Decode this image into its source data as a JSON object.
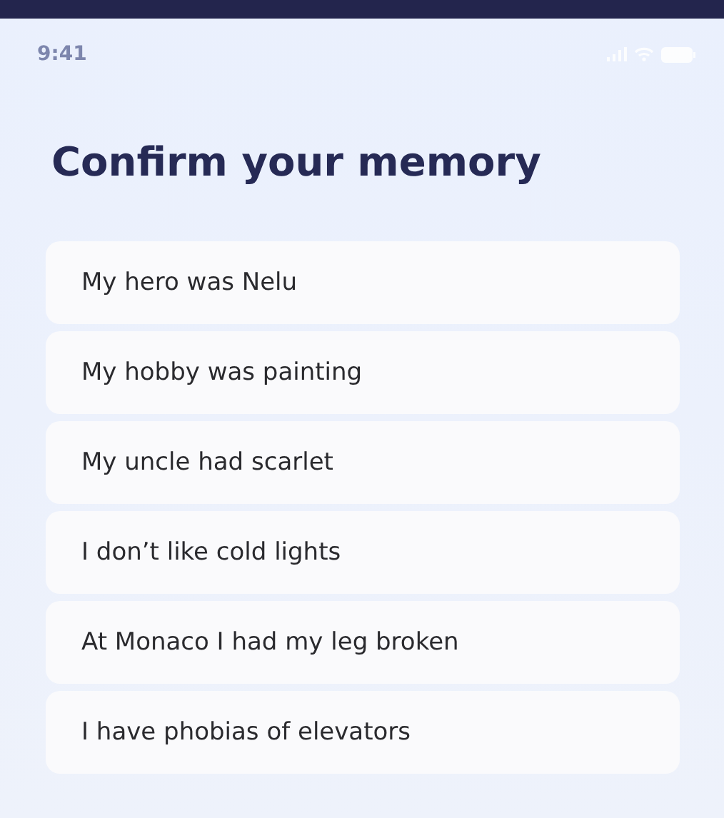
{
  "status_bar": {
    "time": "9:41"
  },
  "title": "Confirm your memory",
  "memories": [
    {
      "text": "My hero was Nelu"
    },
    {
      "text": "My hobby was painting"
    },
    {
      "text": "My uncle had scarlet"
    },
    {
      "text": "I don’t like cold lights"
    },
    {
      "text": "At Monaco I had my leg broken"
    },
    {
      "text": "I have phobias of elevators"
    }
  ]
}
